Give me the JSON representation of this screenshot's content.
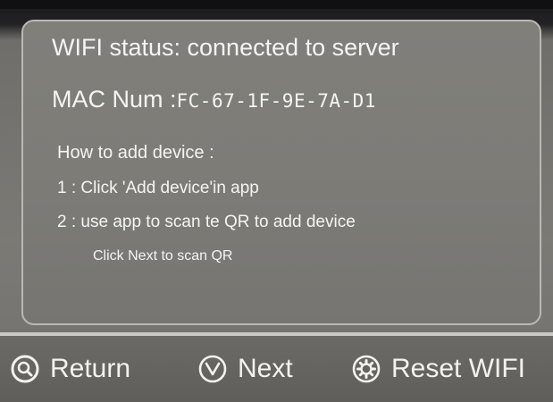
{
  "status": {
    "wifi_status": "WIFI status: connected to server",
    "mac_label": "MAC Num :",
    "mac_value": "FC-67-1F-9E-7A-D1"
  },
  "instructions": {
    "title": "How to add device :",
    "step1": "1 : Click 'Add device'in app",
    "step2": "2 : use app to scan te QR to add device",
    "hint": "Click Next to scan QR"
  },
  "buttons": {
    "return_label": "Return",
    "return_icon": "search-icon",
    "next_label": "Next",
    "next_icon": "chevron-down-icon",
    "reset_label": "Reset WIFI",
    "reset_icon": "gear-icon"
  },
  "colors": {
    "text": "#f4f4f2",
    "panel_border": "#b9b8b2",
    "background": "#7b7a75"
  }
}
